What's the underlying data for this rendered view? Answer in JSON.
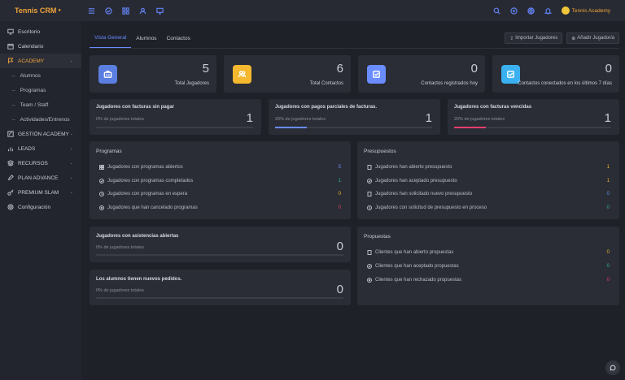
{
  "app": {
    "logo": "Tennis CRM",
    "user_name": "Tennis Academy"
  },
  "topbar": {
    "left_icons": [
      "menu-icon",
      "check-circle-icon",
      "grid-icon",
      "users-icon",
      "monitor-icon"
    ],
    "right_icons": [
      "search-icon",
      "plus-circle-icon",
      "globe-icon",
      "bell-icon"
    ]
  },
  "sidebar": {
    "items": [
      {
        "label": "Escritorio",
        "icon": "monitor-icon"
      },
      {
        "label": "Calendario",
        "icon": "calendar-icon"
      },
      {
        "label": "ACADEMY",
        "icon": "flag-icon",
        "active": true
      },
      {
        "label": "Alumnos",
        "sub": true
      },
      {
        "label": "Programas",
        "sub": true
      },
      {
        "label": "Team / Staff",
        "sub": true
      },
      {
        "label": "Actividades/Entrenos",
        "sub": true
      },
      {
        "label": "GESTIÓN ACADEMY",
        "icon": "edit-icon"
      },
      {
        "label": "LEADS",
        "icon": "bar-chart-icon"
      },
      {
        "label": "RECURSOS",
        "icon": "layers-icon"
      },
      {
        "label": "PLAN ADVANCE",
        "icon": "edit-icon"
      },
      {
        "label": "PREMIUM SLAM",
        "icon": "key-icon"
      },
      {
        "label": "Configuración",
        "icon": "gear-icon"
      }
    ]
  },
  "tabs": [
    "Vista General",
    "Alumnos",
    "Contactos"
  ],
  "actions": {
    "import": "Importar Jugadores",
    "add": "Añadir Jugador/a"
  },
  "stats": [
    {
      "value": "5",
      "label": "Total Jugadores",
      "color": "#5b7fe0",
      "icon": "briefcase-icon"
    },
    {
      "value": "6",
      "label": "Total Contactos",
      "color": "#f5b82e",
      "icon": "users-icon"
    },
    {
      "value": "0",
      "label": "Contactos registrados hoy",
      "color": "#6a8cff",
      "icon": "check-square-icon"
    },
    {
      "value": "0",
      "label": "Contactos conectados en los últimos 7 días",
      "color": "#3ab0f0",
      "icon": "check-square-icon"
    }
  ],
  "bills": [
    {
      "title": "Jugadores con facturas sin pagar",
      "sub": "0% de jugadores totales",
      "value": "1",
      "fill": 0,
      "color": "#6a8cff"
    },
    {
      "title": "Jugadores con pagos parciales de facturas.",
      "sub": "20% de jugadores totales",
      "value": "1",
      "fill": 0.2,
      "color": "#6a8cff"
    },
    {
      "title": "Jugadores con facturas vencidas",
      "sub": "20% de jugadores totales",
      "value": "1",
      "fill": 0.2,
      "color": "#e83e6b"
    }
  ],
  "programas": {
    "title": "Programas",
    "rows": [
      {
        "label": "Jugadores con programas abiertos",
        "value": "5",
        "color": "#6a8cff",
        "icon": "grid-icon"
      },
      {
        "label": "Jugadores con programas completados",
        "value": "1",
        "color": "#2bb5a0",
        "icon": "check-circle-icon"
      },
      {
        "label": "Jugadores con programas en espera",
        "value": "0",
        "color": "#f5b82e",
        "icon": "clock-icon"
      },
      {
        "label": "Jugadores que han cancelado programas",
        "value": "0",
        "color": "#e83e6b",
        "icon": "x-circle-icon"
      }
    ]
  },
  "presupuestos": {
    "title": "Presupuestos",
    "rows": [
      {
        "label": "Jugadores han abierto presupuesto",
        "value": "1",
        "color": "#f5b82e",
        "icon": "doc-icon"
      },
      {
        "label": "Jugadores han aceptado presupuesto",
        "value": "1",
        "color": "#f5b82e",
        "icon": "check-circle-icon"
      },
      {
        "label": "Jugadores han solicitado nuevo presupuesto",
        "value": "0",
        "color": "#6a8cff",
        "icon": "doc-icon"
      },
      {
        "label": "Jugadores con solicitud de presupuesto en proceso",
        "value": "0",
        "color": "#2bb5a0",
        "icon": "clock-icon"
      }
    ]
  },
  "asistencias": {
    "title": "Jugadores con asistencias abiertas",
    "sub": "0% de jugadores totales",
    "value": "0"
  },
  "pedidos": {
    "title": "Los alumnos tienen nuevos pedidos.",
    "sub": "0% de jugadores totales",
    "value": "0"
  },
  "propuestas": {
    "title": "Propuestas",
    "rows": [
      {
        "label": "Clientes que han abierto propuestas",
        "value": "0",
        "color": "#f5b82e",
        "icon": "doc-icon"
      },
      {
        "label": "Clientes que han aceptado propuestas",
        "value": "0",
        "color": "#2bb5a0",
        "icon": "check-circle-icon"
      },
      {
        "label": "Clientes que han rechazado propuestas",
        "value": "0",
        "color": "#e83e6b",
        "icon": "x-circle-icon"
      }
    ]
  }
}
